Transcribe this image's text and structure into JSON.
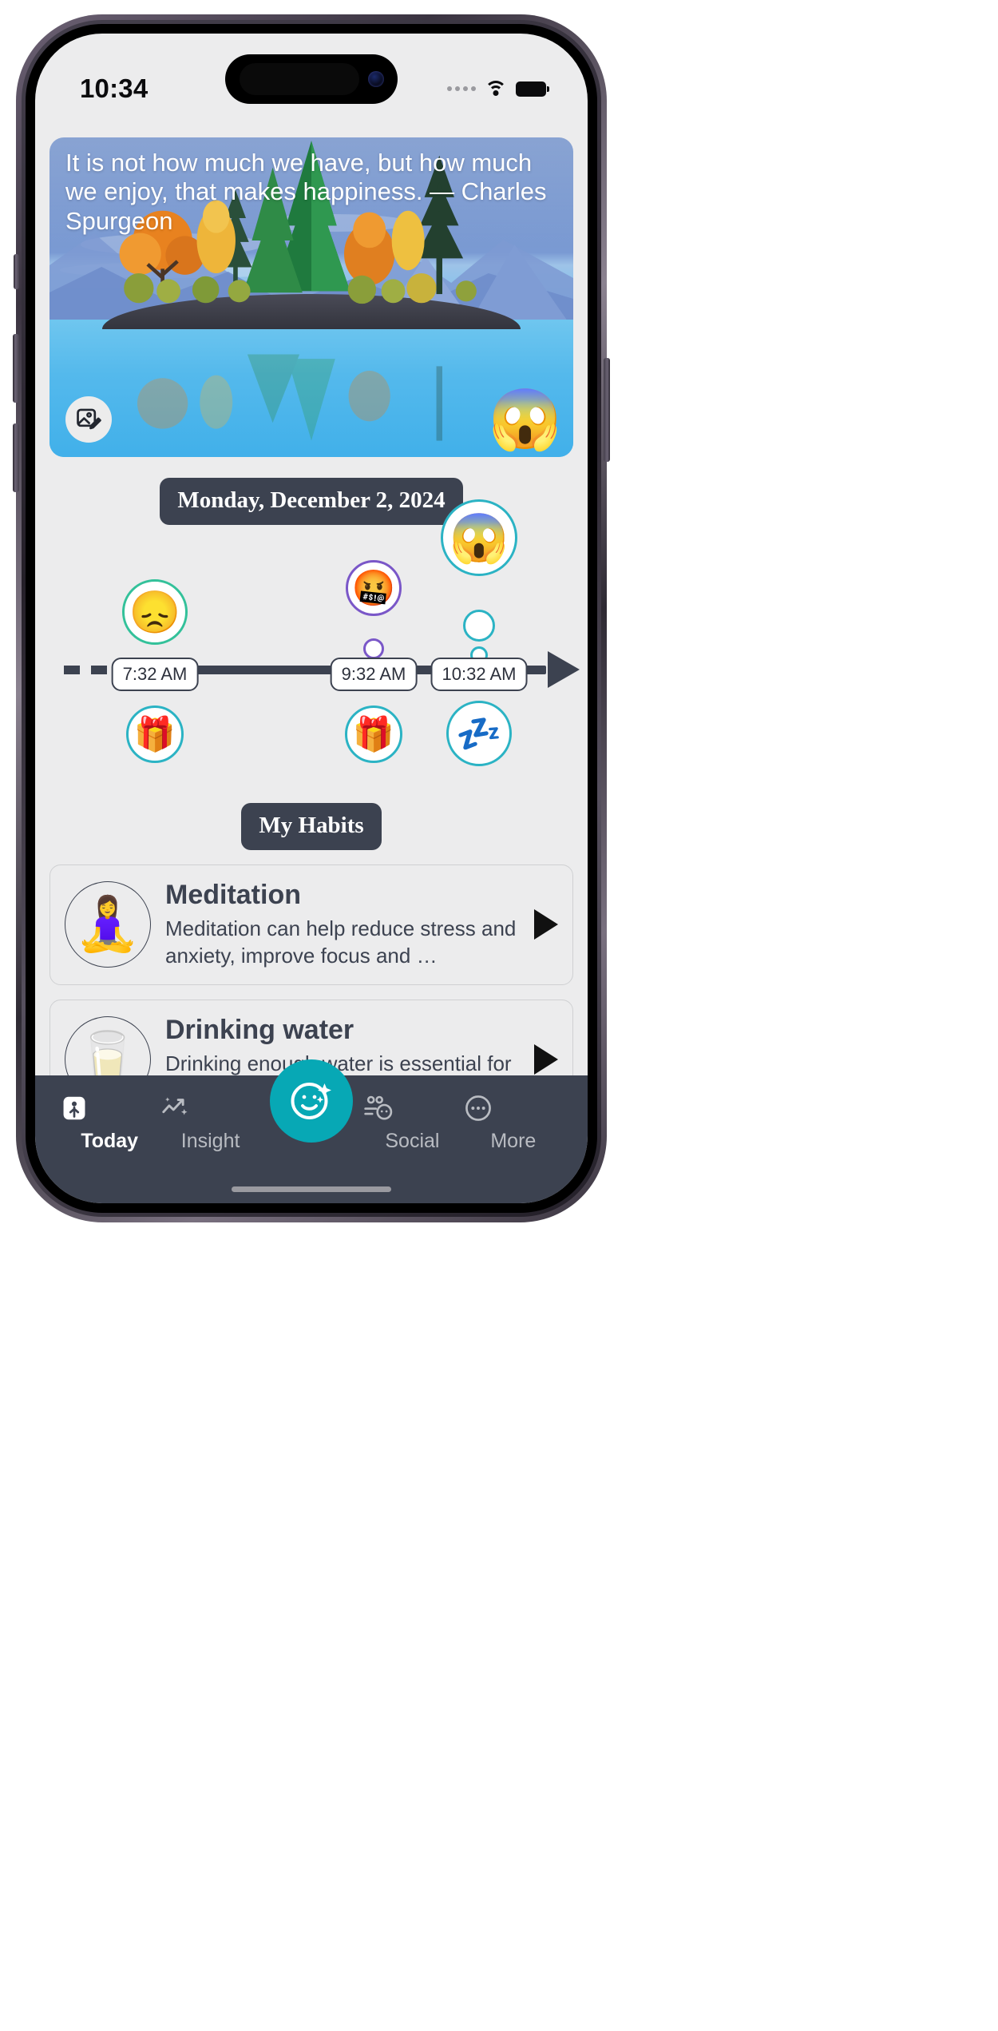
{
  "status_bar": {
    "time": "10:34",
    "cellular_icon": "cellular-dots-icon",
    "wifi_icon": "wifi-icon",
    "battery_icon": "battery-icon"
  },
  "quote_card": {
    "text": "It is not how much we have, but how much we enjoy, that makes happiness. — Charles Spurgeon",
    "edit_icon": "image-edit-icon",
    "mood_emoji": "😱",
    "mood_name": "screaming-face-emoji"
  },
  "date_pill": {
    "label": "Monday, December 2, 2024"
  },
  "timeline": {
    "entries": [
      {
        "time": "7:32 AM",
        "mood_emoji": "😞",
        "mood_name": "disappointed-face-emoji",
        "reward_emoji": "🎁",
        "reward_name": "gift-emoji",
        "ring_color": "#33c19a",
        "has_sub_dot": false
      },
      {
        "time": "9:32 AM",
        "mood_emoji": "🤬",
        "mood_name": "cursing-face-emoji",
        "reward_emoji": "🎁",
        "reward_name": "gift-emoji",
        "ring_color": "#7a57c8",
        "has_sub_dot": true
      },
      {
        "time": "10:32 AM",
        "mood_emoji": "😱",
        "mood_name": "screaming-face-emoji",
        "reward_emoji": "💤",
        "reward_name": "sleep-emoji",
        "ring_color": "#2bb3c4",
        "has_sub_dot": true
      }
    ]
  },
  "habits_section": {
    "title": "My Habits",
    "items": [
      {
        "name": "Meditation",
        "description": "Meditation can help reduce stress and anxiety, improve focus and …",
        "avatar_emoji": "🧘‍♀️",
        "avatar_name": "meditating-person-icon",
        "play_icon": "play-icon"
      },
      {
        "name": "Drinking water",
        "description": "Drinking enough water is essential for maintaining good h…",
        "avatar_emoji": "🥛",
        "avatar_name": "glass-of-water-icon",
        "play_icon": "play-icon"
      }
    ]
  },
  "bottom_nav": {
    "items": [
      {
        "label": "Today",
        "icon": "today-calendar-icon",
        "active": true
      },
      {
        "label": "Insight",
        "icon": "trending-sparkle-icon",
        "active": false
      },
      {
        "label": "Social",
        "icon": "people-chat-icon",
        "active": false
      },
      {
        "label": "More",
        "icon": "ellipsis-circle-icon",
        "active": false
      }
    ],
    "fab_icon": "smiley-sparkle-icon",
    "accent_color": "#07a8b5",
    "background_color": "#3c4250"
  }
}
